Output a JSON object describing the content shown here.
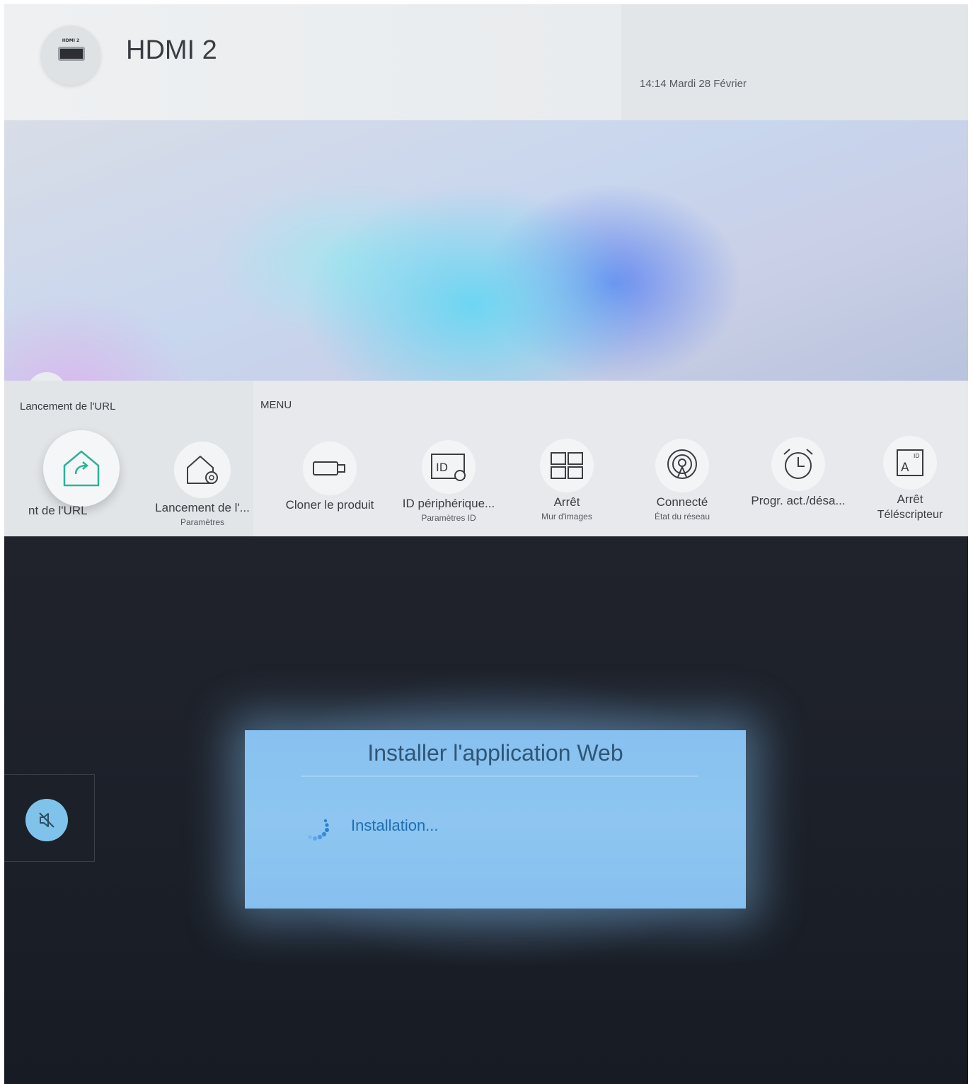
{
  "top": {
    "source_chip_label": "HDMI 2",
    "source_title": "HDMI 2",
    "datetime": "14:14 Mardi 28 Février",
    "url_section_label": "Lancement de l'URL",
    "menu_section_label": "MENU",
    "tiles": [
      {
        "label": "nt de l'URL",
        "sub": "",
        "icon": "url-launcher-home-icon"
      },
      {
        "label": "Lancement de l'...",
        "sub": "Paramètres",
        "icon": "url-launcher-settings-icon"
      },
      {
        "label": "Cloner le produit",
        "sub": "",
        "icon": "usb-clone-icon"
      },
      {
        "label": "ID périphérique...",
        "sub": "Paramètres ID",
        "icon": "device-id-icon"
      },
      {
        "label": "Arrêt",
        "sub": "Mur d'images",
        "icon": "video-wall-icon"
      },
      {
        "label": "Connecté",
        "sub": "État du réseau",
        "icon": "network-status-icon"
      },
      {
        "label": "Progr. act./désa...",
        "sub": "",
        "icon": "alarm-clock-icon"
      },
      {
        "label": "Arrêt",
        "sub": "Téléscripteur",
        "icon": "ticker-icon"
      }
    ]
  },
  "bottom": {
    "dialog_title": "Installer l'application Web",
    "dialog_status": "Installation..."
  },
  "colors": {
    "dialog_bg": "#8ec6f1",
    "dialog_title": "#2f5675",
    "status_text": "#1f6fb0",
    "accent_green": "#2bb39a"
  }
}
